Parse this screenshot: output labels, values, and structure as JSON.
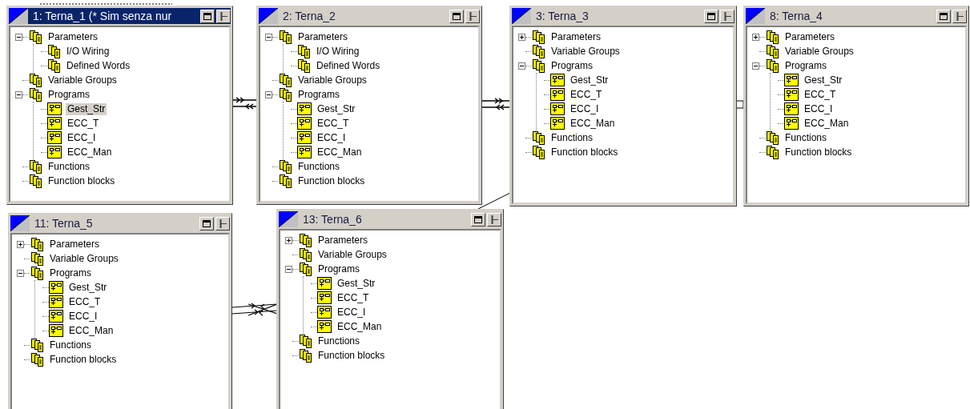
{
  "windows": [
    {
      "title": "1: Terna_1 (* Sim senza nur",
      "active": true,
      "items": [
        {
          "label": "Parameters",
          "kind": "folder",
          "expanded": true,
          "selected": false,
          "children": [
            {
              "label": "I/O Wiring",
              "kind": "folder",
              "selected": false
            },
            {
              "label": "Defined Words",
              "kind": "folder",
              "selected": false
            }
          ]
        },
        {
          "label": "Variable Groups",
          "kind": "folder",
          "selected": false
        },
        {
          "label": "Programs",
          "kind": "folder",
          "expanded": true,
          "selected": false,
          "children": [
            {
              "label": "Gest_Str",
              "kind": "program",
              "selected": true
            },
            {
              "label": "ECC_T",
              "kind": "program",
              "selected": false
            },
            {
              "label": "ECC_I",
              "kind": "program",
              "selected": false
            },
            {
              "label": "ECC_Man",
              "kind": "program",
              "selected": false
            }
          ]
        },
        {
          "label": "Functions",
          "kind": "folder",
          "selected": false
        },
        {
          "label": "Function blocks",
          "kind": "folder",
          "selected": false
        }
      ]
    },
    {
      "title": "2: Terna_2",
      "active": false,
      "items": [
        {
          "label": "Parameters",
          "kind": "folder",
          "expanded": true,
          "selected": false,
          "children": [
            {
              "label": "I/O Wiring",
              "kind": "folder",
              "selected": false
            },
            {
              "label": "Defined Words",
              "kind": "folder",
              "selected": false
            }
          ]
        },
        {
          "label": "Variable Groups",
          "kind": "folder",
          "selected": false
        },
        {
          "label": "Programs",
          "kind": "folder",
          "expanded": true,
          "selected": false,
          "children": [
            {
              "label": "Gest_Str",
              "kind": "program",
              "selected": false
            },
            {
              "label": "ECC_T",
              "kind": "program",
              "selected": false
            },
            {
              "label": "ECC_I",
              "kind": "program",
              "selected": false
            },
            {
              "label": "ECC_Man",
              "kind": "program",
              "selected": false
            }
          ]
        },
        {
          "label": "Functions",
          "kind": "folder",
          "selected": false
        },
        {
          "label": "Function blocks",
          "kind": "folder",
          "selected": false
        }
      ]
    },
    {
      "title": "3: Terna_3",
      "active": false,
      "items": [
        {
          "label": "Parameters",
          "kind": "folder",
          "expanded": false,
          "selected": false
        },
        {
          "label": "Variable Groups",
          "kind": "folder",
          "selected": false
        },
        {
          "label": "Programs",
          "kind": "folder",
          "expanded": true,
          "selected": false,
          "children": [
            {
              "label": "Gest_Str",
              "kind": "program",
              "selected": false
            },
            {
              "label": "ECC_T",
              "kind": "program",
              "selected": false
            },
            {
              "label": "ECC_I",
              "kind": "program",
              "selected": false
            },
            {
              "label": "ECC_Man",
              "kind": "program",
              "selected": false
            }
          ]
        },
        {
          "label": "Functions",
          "kind": "folder",
          "selected": false
        },
        {
          "label": "Function blocks",
          "kind": "folder",
          "selected": false
        }
      ]
    },
    {
      "title": "8: Terna_4",
      "active": false,
      "items": [
        {
          "label": "Parameters",
          "kind": "folder",
          "expanded": false,
          "selected": false
        },
        {
          "label": "Variable Groups",
          "kind": "folder",
          "selected": false
        },
        {
          "label": "Programs",
          "kind": "folder",
          "expanded": true,
          "selected": false,
          "children": [
            {
              "label": "Gest_Str",
              "kind": "program",
              "selected": false
            },
            {
              "label": "ECC_T",
              "kind": "program",
              "selected": false
            },
            {
              "label": "ECC_I",
              "kind": "program",
              "selected": false
            },
            {
              "label": "ECC_Man",
              "kind": "program",
              "selected": false
            }
          ]
        },
        {
          "label": "Functions",
          "kind": "folder",
          "selected": false
        },
        {
          "label": "Function blocks",
          "kind": "folder",
          "selected": false
        }
      ]
    },
    {
      "title": "11: Terna_5",
      "active": false,
      "items": [
        {
          "label": "Parameters",
          "kind": "folder",
          "expanded": false,
          "selected": false
        },
        {
          "label": "Variable Groups",
          "kind": "folder",
          "selected": false
        },
        {
          "label": "Programs",
          "kind": "folder",
          "expanded": true,
          "selected": false,
          "children": [
            {
              "label": "Gest_Str",
              "kind": "program",
              "selected": false
            },
            {
              "label": "ECC_T",
              "kind": "program",
              "selected": false
            },
            {
              "label": "ECC_I",
              "kind": "program",
              "selected": false
            },
            {
              "label": "ECC_Man",
              "kind": "program",
              "selected": false
            }
          ]
        },
        {
          "label": "Functions",
          "kind": "folder",
          "selected": false
        },
        {
          "label": "Function blocks",
          "kind": "folder",
          "selected": false
        }
      ]
    },
    {
      "title": "13: Terna_6",
      "active": false,
      "items": [
        {
          "label": "Parameters",
          "kind": "folder",
          "expanded": false,
          "selected": false
        },
        {
          "label": "Variable Groups",
          "kind": "folder",
          "selected": false
        },
        {
          "label": "Programs",
          "kind": "folder",
          "expanded": true,
          "selected": false,
          "children": [
            {
              "label": "Gest_Str",
              "kind": "program",
              "selected": false
            },
            {
              "label": "ECC_T",
              "kind": "program",
              "selected": false
            },
            {
              "label": "ECC_I",
              "kind": "program",
              "selected": false
            },
            {
              "label": "ECC_Man",
              "kind": "program",
              "selected": false
            }
          ]
        },
        {
          "label": "Functions",
          "kind": "folder",
          "selected": false
        },
        {
          "label": "Function blocks",
          "kind": "folder",
          "selected": false
        }
      ]
    }
  ]
}
